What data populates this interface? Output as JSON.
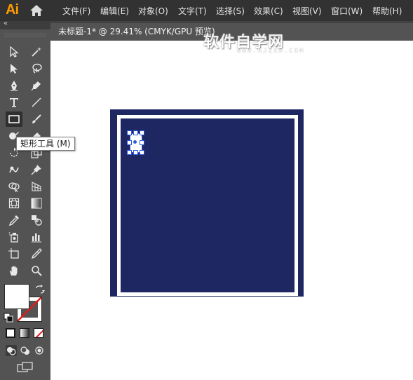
{
  "app": {
    "logo": "Ai",
    "home_icon": "home-icon"
  },
  "menu": {
    "items": [
      "文件(F)",
      "编辑(E)",
      "对象(O)",
      "文字(T)",
      "选择(S)",
      "效果(C)",
      "视图(V)",
      "窗口(W)",
      "帮助(H)"
    ]
  },
  "document": {
    "tab_title": "未标题-1* @ 29.41% (CMYK/GPU 预览)"
  },
  "watermark": {
    "main": "软件自学网",
    "sub": "WWW.RJZXW.COM"
  },
  "tools": {
    "collapse_icon": "double-chevron-left-icon",
    "tooltip": "矩形工具 (M)",
    "active_tool": "rectangle-tool"
  },
  "colors": {
    "menubar_bg": "#323232",
    "panel_bg": "#535353",
    "artwork_fill": "#1f2763",
    "selection_color": "#2c5cd8",
    "logo_color": "#ff9a00"
  }
}
